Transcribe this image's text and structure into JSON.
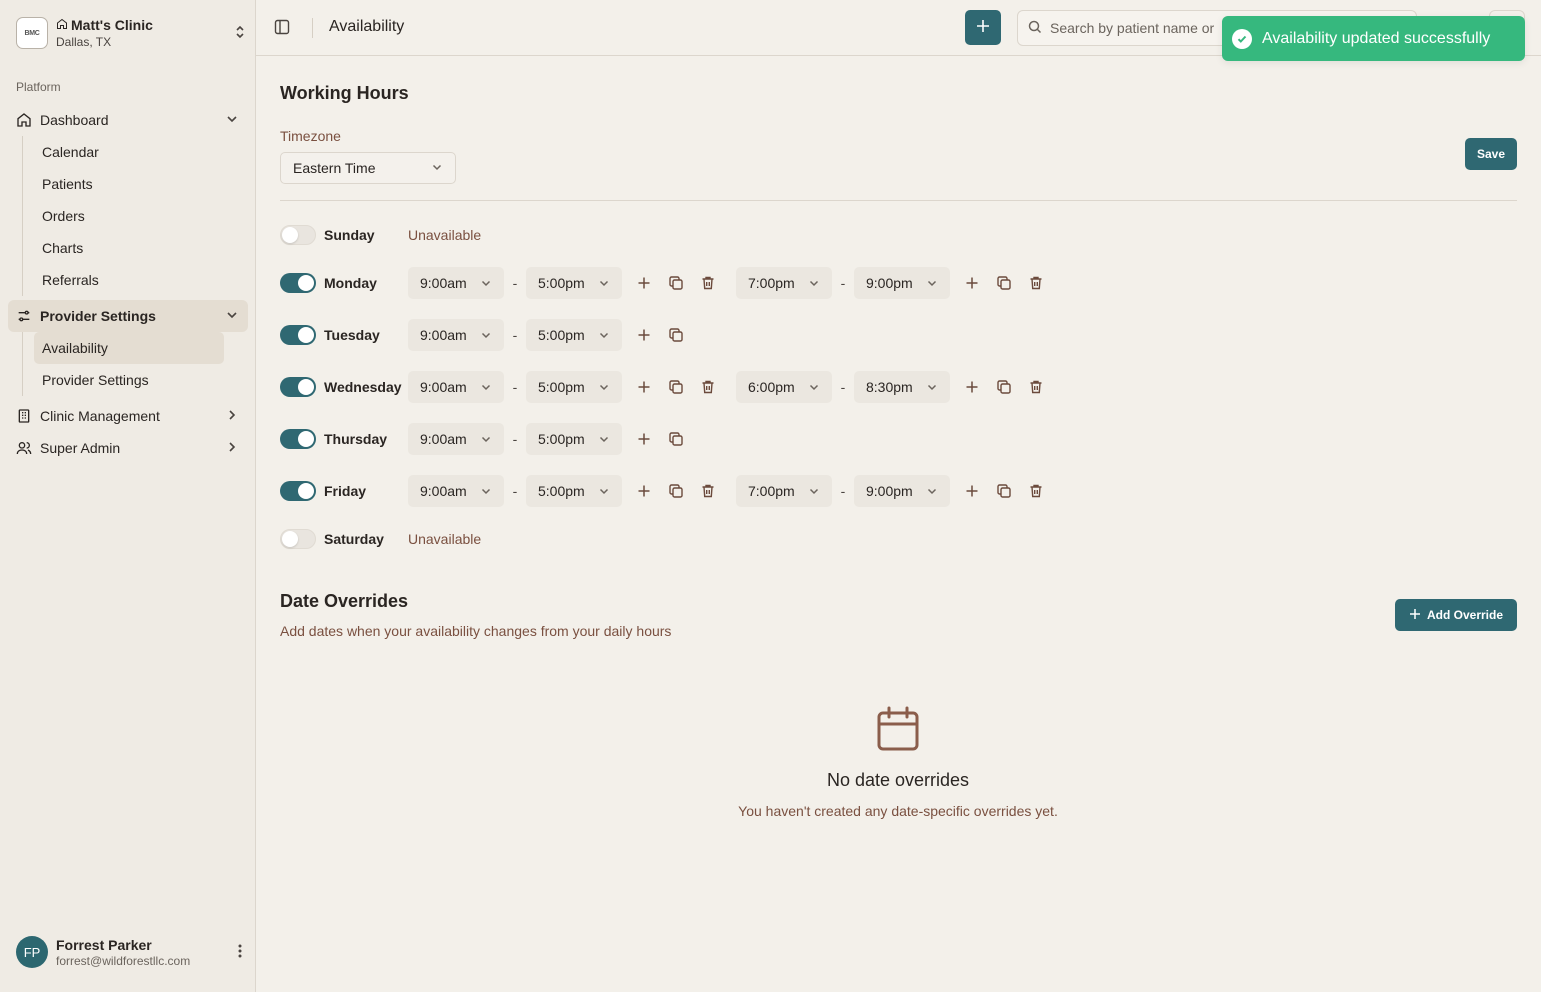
{
  "clinic": {
    "logo_text": "BMC",
    "name": "Matt's Clinic",
    "location": "Dallas, TX"
  },
  "sidebar": {
    "section_label": "Platform",
    "dashboard": {
      "label": "Dashboard",
      "items": [
        "Calendar",
        "Patients",
        "Orders",
        "Charts",
        "Referrals"
      ]
    },
    "provider_settings": {
      "label": "Provider Settings",
      "items": [
        "Availability",
        "Provider Settings"
      ]
    },
    "clinic_management": {
      "label": "Clinic Management"
    },
    "super_admin": {
      "label": "Super Admin"
    }
  },
  "user": {
    "initials": "FP",
    "name": "Forrest Parker",
    "email": "forrest@wildforestllc.com"
  },
  "header": {
    "title": "Availability",
    "search_placeholder": "Search by patient name or"
  },
  "toast": {
    "message": "Availability updated successfully"
  },
  "working_hours": {
    "title": "Working Hours",
    "timezone_label": "Timezone",
    "timezone_value": "Eastern Time",
    "save_label": "Save",
    "unavailable_label": "Unavailable",
    "days": [
      {
        "name": "Sunday",
        "enabled": false,
        "slots": []
      },
      {
        "name": "Monday",
        "enabled": true,
        "slots": [
          [
            "9:00am",
            "5:00pm"
          ],
          [
            "7:00pm",
            "9:00pm"
          ]
        ]
      },
      {
        "name": "Tuesday",
        "enabled": true,
        "slots": [
          [
            "9:00am",
            "5:00pm"
          ]
        ]
      },
      {
        "name": "Wednesday",
        "enabled": true,
        "slots": [
          [
            "9:00am",
            "5:00pm"
          ],
          [
            "6:00pm",
            "8:30pm"
          ]
        ]
      },
      {
        "name": "Thursday",
        "enabled": true,
        "slots": [
          [
            "9:00am",
            "5:00pm"
          ]
        ]
      },
      {
        "name": "Friday",
        "enabled": true,
        "slots": [
          [
            "9:00am",
            "5:00pm"
          ],
          [
            "7:00pm",
            "9:00pm"
          ]
        ]
      },
      {
        "name": "Saturday",
        "enabled": false,
        "slots": []
      }
    ]
  },
  "date_overrides": {
    "title": "Date Overrides",
    "subtitle": "Add dates when your availability changes from your daily hours",
    "add_label": "Add Override",
    "empty_title": "No date overrides",
    "empty_desc": "You haven't created any date-specific overrides yet."
  },
  "colors": {
    "accent": "#2f6872",
    "toast": "#36b87e",
    "muted_text": "#7a5040"
  }
}
